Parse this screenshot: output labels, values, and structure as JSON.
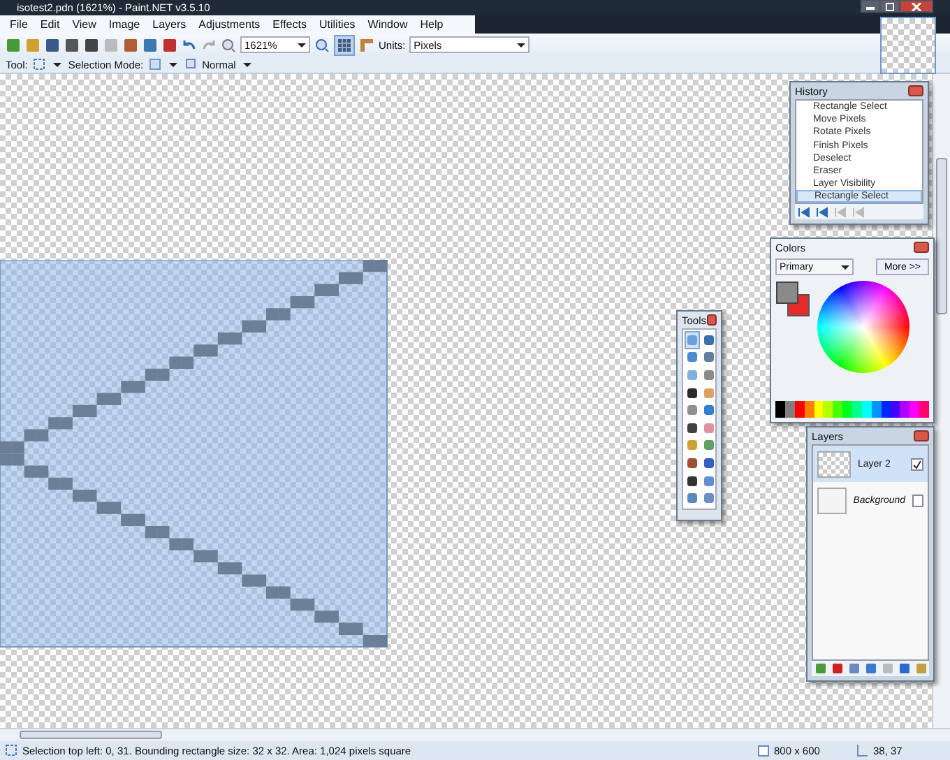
{
  "window": {
    "title": "isotest2.pdn (1621%) - Paint.NET v3.5.10"
  },
  "menu": [
    "File",
    "Edit",
    "View",
    "Image",
    "Layers",
    "Adjustments",
    "Effects",
    "Utilities",
    "Window",
    "Help"
  ],
  "toolbar": {
    "zoom": "1621%",
    "units_label": "Units:",
    "units": "Pixels"
  },
  "tool_options": {
    "tool_label": "Tool:",
    "selection_mode_label": "Selection Mode:",
    "blend_mode": "Normal"
  },
  "history": {
    "title": "History",
    "items": [
      {
        "label": "Rectangle Select",
        "selected": false
      },
      {
        "label": "Move Pixels",
        "selected": false
      },
      {
        "label": "Rotate Pixels",
        "selected": false
      },
      {
        "label": "Finish Pixels",
        "selected": false
      },
      {
        "label": "Deselect",
        "selected": false
      },
      {
        "label": "Eraser",
        "selected": false
      },
      {
        "label": "Layer Visibility",
        "selected": false
      },
      {
        "label": "Rectangle Select",
        "selected": true
      }
    ]
  },
  "colors": {
    "title": "Colors",
    "selector": "Primary",
    "more_button": "More >>"
  },
  "tools": {
    "title": "Tools",
    "items": [
      {
        "selected": true
      },
      {
        "selected": false
      },
      {
        "selected": false
      },
      {
        "selected": false
      },
      {
        "selected": false
      },
      {
        "selected": false
      },
      {
        "selected": false
      },
      {
        "selected": false
      },
      {
        "selected": false
      },
      {
        "selected": false
      },
      {
        "selected": false
      },
      {
        "selected": false
      },
      {
        "selected": false
      },
      {
        "selected": false
      },
      {
        "selected": false
      },
      {
        "selected": false
      },
      {
        "selected": false
      },
      {
        "selected": false
      },
      {
        "selected": false
      },
      {
        "selected": false
      }
    ]
  },
  "layers": {
    "title": "Layers",
    "items": [
      {
        "name": "Layer 2",
        "visible": true,
        "selected": true
      },
      {
        "name": "Background",
        "visible": false,
        "selected": false
      }
    ]
  },
  "status_bar": {
    "message": "Selection top left: 0, 31. Bounding rectangle size: 32 x 32. Area: 1,024 pixels square",
    "image_size": "800 x 600",
    "cursor": "38, 37"
  }
}
